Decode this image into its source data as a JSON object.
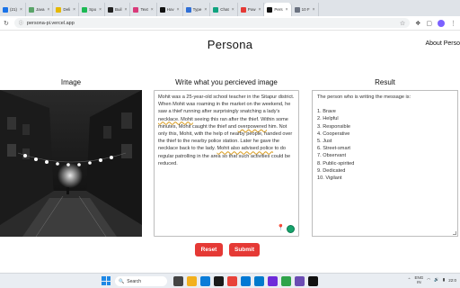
{
  "browser": {
    "tabs": [
      {
        "label": "(21)",
        "color": "#1a73e8"
      },
      {
        "label": "Java",
        "color": "#5aa469"
      },
      {
        "label": "Deli",
        "color": "#e6b800"
      },
      {
        "label": "Spo",
        "color": "#1db954"
      },
      {
        "label": "Buil",
        "color": "#222222"
      },
      {
        "label": "Text",
        "color": "#d93a7a"
      },
      {
        "label": "Hov",
        "color": "#111111"
      },
      {
        "label": "Type",
        "color": "#2f6fd6"
      },
      {
        "label": "Chat",
        "color": "#10a37f"
      },
      {
        "label": "Pow",
        "color": "#e53935"
      },
      {
        "label": "Pers",
        "color": "#111111"
      },
      {
        "label": "10 F",
        "color": "#6b7280"
      }
    ],
    "active_tab_index": 10,
    "url": "persona-pi.vercel.app"
  },
  "page": {
    "title": "Persona",
    "about_link": "About Perso",
    "image_heading": "Image",
    "input_heading": "Write what you percieved image",
    "result_heading": "Result",
    "input_text_parts": [
      {
        "t": "Mohit was a 25-year-old school teacher in the Sitapur district. When Mohit was roaming in the market on the weekend, he saw a thief running after surprisingly snatching a lady's ",
        "c": ""
      },
      {
        "t": "necklace. Mohit",
        "c": "sp"
      },
      {
        "t": " seeing this ran after the thief. Within some minutes, Mohit caught the thief and ",
        "c": ""
      },
      {
        "t": "overpowered",
        "c": "sp"
      },
      {
        "t": " him. Not only this, Mohit, with the help of nearby people, handed over the thief to the nearby police station. Later he gave the necklace back to the lady. ",
        "c": ""
      },
      {
        "t": "Mohit also advised police",
        "c": "sp"
      },
      {
        "t": " to do regular patrolling in the area so that such activities could be reduced.",
        "c": ""
      }
    ],
    "result_intro": "The person who is writing the message is:",
    "result_items": [
      "1. Brave",
      "2. Helpful",
      "3. Responsible",
      "4. Cooperative",
      "5. Just",
      "6. Street-smart",
      "7. Observant",
      "8. Public-spirited",
      "9. Dedicated",
      "10. Vigilant"
    ],
    "reset_label": "Reset",
    "submit_label": "Submit",
    "button_color": "#e53935"
  },
  "taskbar": {
    "search_placeholder": "Search",
    "lang_top": "ENG",
    "lang_bottom": "IN",
    "clock": "22:0"
  }
}
